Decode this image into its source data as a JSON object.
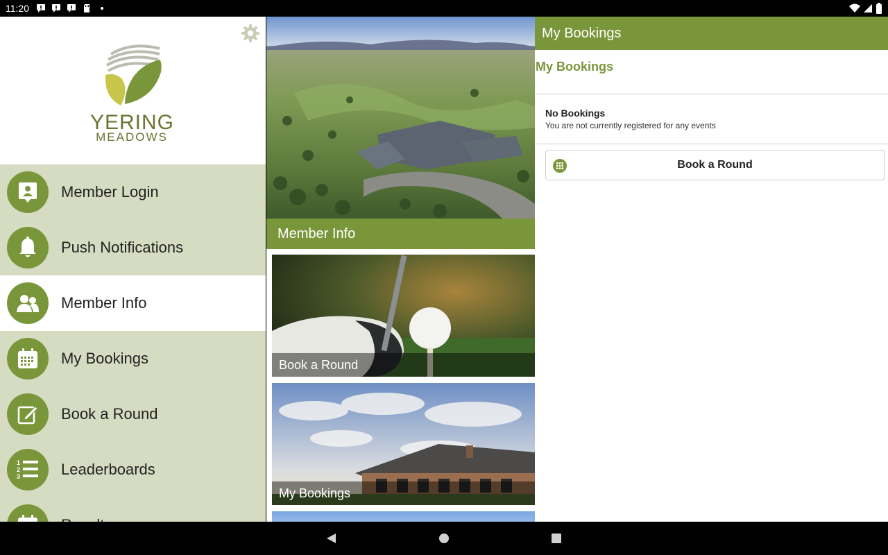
{
  "status_bar": {
    "time": "11:20",
    "left_icons": [
      "message-notification-icon",
      "message-notification-icon",
      "message-notification-icon",
      "sd-card-icon",
      "dot-icon"
    ],
    "right_icons": [
      "wifi-icon",
      "signal-icon",
      "battery-icon"
    ]
  },
  "drawer": {
    "logo": {
      "line1": "YERING",
      "line2": "MEADOWS"
    },
    "settings_icon": "gear-icon",
    "items": [
      {
        "label": "Member Login",
        "icon": "member-card-icon",
        "active": false
      },
      {
        "label": "Push Notifications",
        "icon": "bell-icon",
        "active": false
      },
      {
        "label": "Member Info",
        "icon": "people-icon",
        "active": true
      },
      {
        "label": "My Bookings",
        "icon": "calendar-icon",
        "active": false
      },
      {
        "label": "Book a Round",
        "icon": "edit-icon",
        "active": false
      },
      {
        "label": "Leaderboards",
        "icon": "ranked-list-icon",
        "active": false
      },
      {
        "label": "Results",
        "icon": "calendar-icon",
        "active": false
      }
    ]
  },
  "middle": {
    "section_title": "Member Info",
    "tiles": [
      {
        "caption": "Book a Round"
      },
      {
        "caption": "My Bookings"
      }
    ]
  },
  "right": {
    "appbar_title": "My Bookings",
    "heading": "My Bookings",
    "empty_title": "No Bookings",
    "empty_subtitle": "You are not currently registered for any events",
    "book_button_label": "Book a Round"
  },
  "colors": {
    "accent": "#7a963b",
    "drawer_bg": "#d6dcc2",
    "logo_text": "#6e7330"
  }
}
